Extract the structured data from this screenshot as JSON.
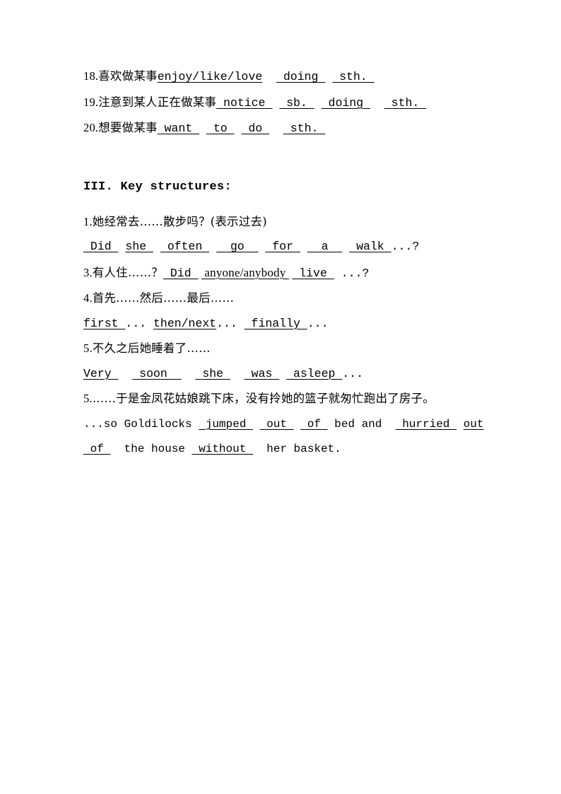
{
  "document": {
    "page_background": "#ffffff",
    "text_color": "#000000",
    "phrases_section": {
      "items": [
        {
          "number": "18.",
          "chinese": "喜欢做某事",
          "segments": [
            {
              "text": "enjoy/like/love",
              "blank": true
            },
            {
              "text": "  ",
              "blank": false
            },
            {
              "text": " doing ",
              "blank": true
            },
            {
              "text": " ",
              "blank": false
            },
            {
              "text": " sth. ",
              "blank": true
            }
          ]
        },
        {
          "number": "19.",
          "chinese": "注意到某人正在做某事",
          "segments": [
            {
              "text": " notice ",
              "blank": true
            },
            {
              "text": " ",
              "blank": false
            },
            {
              "text": " sb. ",
              "blank": true
            },
            {
              "text": " ",
              "blank": false
            },
            {
              "text": " doing ",
              "blank": true
            },
            {
              "text": "  ",
              "blank": false
            },
            {
              "text": " sth. ",
              "blank": true
            }
          ]
        },
        {
          "number": "20.",
          "chinese": "想要做某事",
          "segments": [
            {
              "text": " want ",
              "blank": true
            },
            {
              "text": " ",
              "blank": false
            },
            {
              "text": " to ",
              "blank": true
            },
            {
              "text": " ",
              "blank": false
            },
            {
              "text": " do ",
              "blank": true
            },
            {
              "text": "  ",
              "blank": false
            },
            {
              "text": " sth. ",
              "blank": true
            }
          ]
        }
      ]
    },
    "key_structures": {
      "heading": "III. Key structures:",
      "entries": [
        {
          "prompt_number": "1.",
          "prompt_chinese": "她经常去……散步吗？(表示过去)",
          "answer_segments": [
            {
              "text": " Did ",
              "blank": true
            },
            {
              "text": " ",
              "blank": false
            },
            {
              "text": "she ",
              "blank": true
            },
            {
              "text": " ",
              "blank": false
            },
            {
              "text": " often ",
              "blank": true
            },
            {
              "text": " ",
              "blank": false
            },
            {
              "text": "  go  ",
              "blank": true
            },
            {
              "text": " ",
              "blank": false
            },
            {
              "text": " for ",
              "blank": true
            },
            {
              "text": " ",
              "blank": false
            },
            {
              "text": "  a  ",
              "blank": true
            },
            {
              "text": " ",
              "blank": false
            },
            {
              "text": " walk ",
              "blank": true
            },
            {
              "text": "...?",
              "blank": false
            }
          ]
        },
        {
          "prompt_number": "3.",
          "prompt_chinese": "有人住……？",
          "inline": true,
          "answer_segments": [
            {
              "text": " Did ",
              "blank": true
            },
            {
              "text": " ",
              "blank": false
            },
            {
              "text": " anyone/anybody ",
              "blank": true
            },
            {
              "text": " ",
              "blank": false
            },
            {
              "text": " live ",
              "blank": true
            },
            {
              "text": " ...?",
              "blank": false
            }
          ]
        },
        {
          "prompt_number": "4.",
          "prompt_chinese": "首先……然后……最后……",
          "answer_segments": [
            {
              "text": "first ",
              "blank": true
            },
            {
              "text": "... ",
              "blank": false
            },
            {
              "text": "then/next",
              "blank": true
            },
            {
              "text": "... ",
              "blank": false
            },
            {
              "text": " finally ",
              "blank": true
            },
            {
              "text": "...",
              "blank": false
            }
          ]
        },
        {
          "prompt_number": "5.",
          "prompt_chinese": "不久之后她睡着了……",
          "answer_segments": [
            {
              "text": "Very ",
              "blank": true
            },
            {
              "text": "  ",
              "blank": false
            },
            {
              "text": " soon  ",
              "blank": true
            },
            {
              "text": "  ",
              "blank": false
            },
            {
              "text": " she ",
              "blank": true
            },
            {
              "text": "  ",
              "blank": false
            },
            {
              "text": " was ",
              "blank": true
            },
            {
              "text": " ",
              "blank": false
            },
            {
              "text": " asleep ",
              "blank": true
            },
            {
              "text": "...",
              "blank": false
            }
          ]
        }
      ],
      "final_entry": {
        "prompt_number": "5.",
        "prompt_chinese": "……于是金凤花姑娘跳下床，没有拎她的篮子就匆忙跑出了房子。",
        "answer_line_1": [
          {
            "text": "...so Goldilocks ",
            "blank": false
          },
          {
            "text": " jumped ",
            "blank": true
          },
          {
            "text": " ",
            "blank": false
          },
          {
            "text": " out ",
            "blank": true
          },
          {
            "text": " ",
            "blank": false
          },
          {
            "text": " of ",
            "blank": true
          },
          {
            "text": " bed and ",
            "blank": false
          },
          {
            "text": " ",
            "blank": false
          },
          {
            "text": " hurried ",
            "blank": true
          },
          {
            "text": " ",
            "blank": false
          },
          {
            "text": "out",
            "blank": true
          }
        ],
        "answer_line_2": [
          {
            "text": " of ",
            "blank": true
          },
          {
            "text": "  the house ",
            "blank": false
          },
          {
            "text": " without ",
            "blank": true
          },
          {
            "text": "  her basket.",
            "blank": false
          }
        ]
      }
    }
  }
}
